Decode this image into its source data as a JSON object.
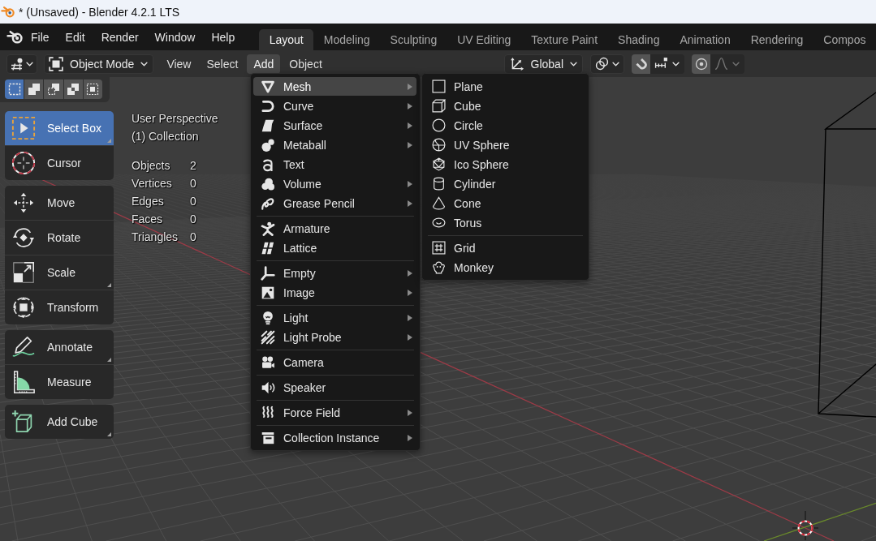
{
  "window": {
    "title": "* (Unsaved) - Blender 4.2.1 LTS"
  },
  "top_bar": {
    "menus": [
      "File",
      "Edit",
      "Render",
      "Window",
      "Help"
    ],
    "workspace_tabs": [
      {
        "label": "Layout",
        "selected": true
      },
      {
        "label": "Modeling",
        "selected": false
      },
      {
        "label": "Sculpting",
        "selected": false
      },
      {
        "label": "UV Editing",
        "selected": false
      },
      {
        "label": "Texture Paint",
        "selected": false
      },
      {
        "label": "Shading",
        "selected": false
      },
      {
        "label": "Animation",
        "selected": false
      },
      {
        "label": "Rendering",
        "selected": false
      },
      {
        "label": "Compos",
        "selected": false
      }
    ]
  },
  "header": {
    "mode": "Object Mode",
    "menus": [
      {
        "label": "View",
        "open": false
      },
      {
        "label": "Select",
        "open": false
      },
      {
        "label": "Add",
        "open": true
      },
      {
        "label": "Object",
        "open": false
      }
    ],
    "orientation": "Global",
    "snap": {
      "on": false
    },
    "proportional_editing": {
      "on": false
    },
    "falloff": {
      "disabled": true
    }
  },
  "tool_settings": {
    "select_modes": [
      {
        "kind": "set",
        "selected": true
      },
      {
        "kind": "extend",
        "selected": false
      },
      {
        "kind": "subtract",
        "selected": false
      },
      {
        "kind": "difference",
        "selected": false
      },
      {
        "kind": "intersect",
        "selected": false
      }
    ]
  },
  "toolbar": {
    "groups": [
      {
        "tools": [
          {
            "label": "Select Box",
            "kind": "select_box",
            "selected": true,
            "variants": true
          },
          {
            "label": "Cursor",
            "kind": "cursor",
            "selected": false,
            "variants": false
          }
        ]
      },
      {
        "tools": [
          {
            "label": "Move",
            "kind": "move",
            "selected": false,
            "variants": false
          },
          {
            "label": "Rotate",
            "kind": "rotate",
            "selected": false,
            "variants": false
          },
          {
            "label": "Scale",
            "kind": "scale",
            "selected": false,
            "variants": true
          },
          {
            "label": "Transform",
            "kind": "transform",
            "selected": false,
            "variants": false
          }
        ]
      },
      {
        "tools": [
          {
            "label": "Annotate",
            "kind": "annotate",
            "selected": false,
            "variants": true
          },
          {
            "label": "Measure",
            "kind": "measure",
            "selected": false,
            "variants": false
          }
        ]
      },
      {
        "tools": [
          {
            "label": "Add Cube",
            "kind": "add_cube",
            "selected": false,
            "variants": true
          }
        ]
      }
    ]
  },
  "viewport": {
    "view_name": "User Perspective",
    "collection": "(1) Collection",
    "stats": [
      {
        "label": "Objects",
        "value": "2"
      },
      {
        "label": "Vertices",
        "value": "0"
      },
      {
        "label": "Edges",
        "value": "0"
      },
      {
        "label": "Faces",
        "value": "0"
      },
      {
        "label": "Triangles",
        "value": "0"
      }
    ]
  },
  "add_menu": {
    "sections": [
      {
        "items": [
          {
            "label": "Mesh",
            "kind": "mesh",
            "submenu": true,
            "selected": true
          },
          {
            "label": "Curve",
            "kind": "curve",
            "submenu": true,
            "selected": false
          },
          {
            "label": "Surface",
            "kind": "surface",
            "submenu": true,
            "selected": false
          },
          {
            "label": "Metaball",
            "kind": "metaball",
            "submenu": true,
            "selected": false
          },
          {
            "label": "Text",
            "kind": "text",
            "submenu": false,
            "selected": false
          },
          {
            "label": "Volume",
            "kind": "volume",
            "submenu": true,
            "selected": false
          },
          {
            "label": "Grease Pencil",
            "kind": "grease_pencil",
            "submenu": true,
            "selected": false
          }
        ]
      },
      {
        "items": [
          {
            "label": "Armature",
            "kind": "armature",
            "submenu": false,
            "selected": false
          },
          {
            "label": "Lattice",
            "kind": "lattice",
            "submenu": false,
            "selected": false
          }
        ]
      },
      {
        "items": [
          {
            "label": "Empty",
            "kind": "empty",
            "submenu": true,
            "selected": false
          },
          {
            "label": "Image",
            "kind": "image",
            "submenu": true,
            "selected": false
          }
        ]
      },
      {
        "items": [
          {
            "label": "Light",
            "kind": "light",
            "submenu": true,
            "selected": false
          },
          {
            "label": "Light Probe",
            "kind": "light_probe",
            "submenu": true,
            "selected": false
          }
        ]
      },
      {
        "items": [
          {
            "label": "Camera",
            "kind": "camera",
            "submenu": false,
            "selected": false
          }
        ]
      },
      {
        "items": [
          {
            "label": "Speaker",
            "kind": "speaker",
            "submenu": false,
            "selected": false
          }
        ]
      },
      {
        "items": [
          {
            "label": "Force Field",
            "kind": "force_field",
            "submenu": true,
            "selected": false
          }
        ]
      },
      {
        "items": [
          {
            "label": "Collection Instance",
            "kind": "collection_instance",
            "submenu": true,
            "selected": false
          }
        ]
      }
    ]
  },
  "mesh_submenu": {
    "sections": [
      {
        "items": [
          {
            "label": "Plane",
            "kind": "plane",
            "selected": false
          },
          {
            "label": "Cube",
            "kind": "cube",
            "selected": false
          },
          {
            "label": "Circle",
            "kind": "circle",
            "selected": false
          },
          {
            "label": "UV Sphere",
            "kind": "uv_sphere",
            "selected": false
          },
          {
            "label": "Ico Sphere",
            "kind": "ico_sphere",
            "selected": false
          },
          {
            "label": "Cylinder",
            "kind": "cylinder",
            "selected": false
          },
          {
            "label": "Cone",
            "kind": "cone",
            "selected": false
          },
          {
            "label": "Torus",
            "kind": "torus",
            "selected": false
          }
        ]
      },
      {
        "items": [
          {
            "label": "Grid",
            "kind": "grid",
            "selected": false
          },
          {
            "label": "Monkey",
            "kind": "monkey",
            "selected": false
          }
        ]
      }
    ]
  }
}
